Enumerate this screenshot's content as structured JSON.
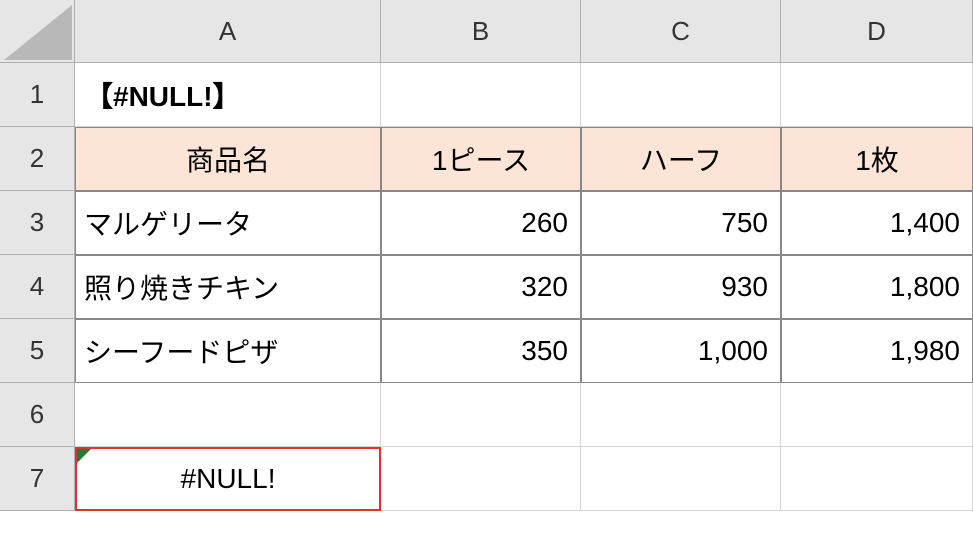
{
  "columns": [
    "A",
    "B",
    "C",
    "D"
  ],
  "rows": [
    "1",
    "2",
    "3",
    "4",
    "5",
    "6",
    "7"
  ],
  "title": "【#NULL!】",
  "headers": {
    "product": "商品名",
    "piece": "1ピース",
    "half": "ハーフ",
    "whole": "1枚"
  },
  "products": [
    {
      "name": "マルゲリータ",
      "piece": "260",
      "half": "750",
      "whole": "1,400"
    },
    {
      "name": "照り焼きチキン",
      "piece": "320",
      "half": "930",
      "whole": "1,800"
    },
    {
      "name": "シーフードピザ",
      "piece": "350",
      "half": "1,000",
      "whole": "1,980"
    }
  ],
  "error_value": "#NULL!",
  "chart_data": {
    "type": "table",
    "title": "【#NULL!】",
    "columns": [
      "商品名",
      "1ピース",
      "ハーフ",
      "1枚"
    ],
    "rows": [
      [
        "マルゲリータ",
        260,
        750,
        1400
      ],
      [
        "照り焼きチキン",
        320,
        930,
        1800
      ],
      [
        "シーフードピザ",
        350,
        1000,
        1980
      ]
    ]
  }
}
